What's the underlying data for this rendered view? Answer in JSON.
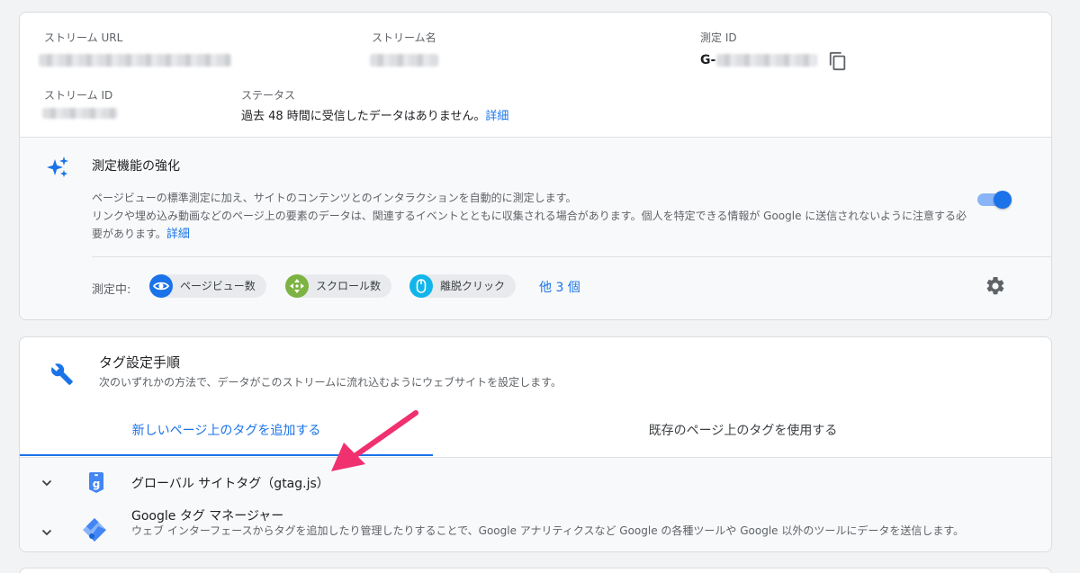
{
  "stream": {
    "url_label": "ストリーム URL",
    "name_label": "ストリーム名",
    "measurement_id_label": "測定 ID",
    "measurement_id_prefix": "G-",
    "stream_id_label": "ストリーム ID",
    "status_label": "ステータス",
    "status_text": "過去 48 時間に受信したデータはありません。",
    "status_link": "詳細"
  },
  "enhanced": {
    "title": "測定機能の強化",
    "desc_line1": "ページビューの標準測定に加え、サイトのコンテンツとのインタラクションを自動的に測定します。",
    "desc_line2": "リンクや埋め込み動画などのページ上の要素のデータは、関連するイベントとともに収集される場合があります。個人を特定できる情報が Google に送信されないように注意する必要があります。",
    "desc_link": "詳細",
    "toggle_on": true,
    "measuring_label": "測定中:",
    "chips": [
      {
        "label": "ページビュー数",
        "icon": "eye-icon",
        "color": "#1a73e8"
      },
      {
        "label": "スクロール数",
        "icon": "scroll-icon",
        "color": "#7cb342"
      },
      {
        "label": "離脱クリック",
        "icon": "mouse-icon",
        "color": "#12b5ea"
      }
    ],
    "more_link": "他 3 個"
  },
  "tagging": {
    "title": "タグ設定手順",
    "desc": "次のいずれかの方法で、データがこのストリームに流れ込むようにウェブサイトを設定します。",
    "tabs": [
      {
        "label": "新しいページ上のタグを追加する",
        "selected": true
      },
      {
        "label": "既存のページ上のタグを使用する",
        "selected": false
      }
    ],
    "options": [
      {
        "title": "グローバル サイトタグ（gtag.js）"
      },
      {
        "title": "Google タグ マネージャー",
        "desc": "ウェブ インターフェースからタグを追加したり管理したりすることで、Google アナリティクスなど Google の各種ツールや Google 以外のツールにデータを送信します。"
      }
    ]
  },
  "colors": {
    "accent": "#1a73e8",
    "annotation_arrow": "#f0306f"
  }
}
